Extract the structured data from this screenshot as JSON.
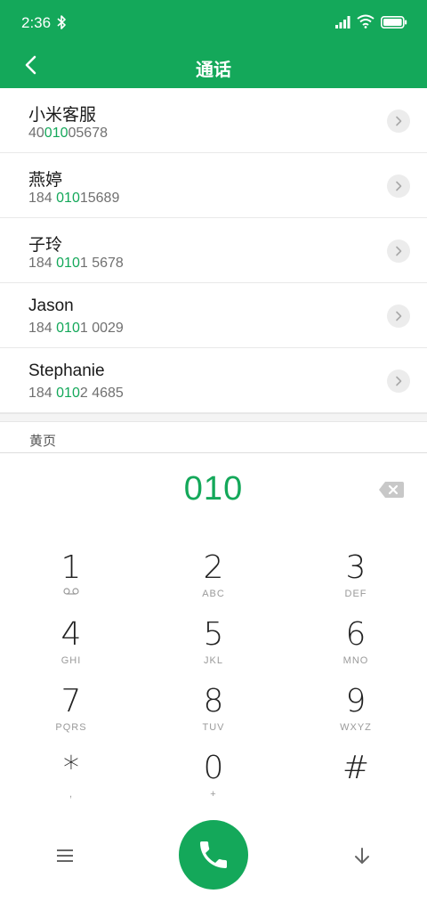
{
  "status_bar": {
    "time": "2:36"
  },
  "header": {
    "title": "通话"
  },
  "contacts": [
    {
      "name": "小米客服",
      "number_pre": "40",
      "number_match": "010",
      "number_post": "05678"
    },
    {
      "name": "燕婷",
      "number_pre": "184 ",
      "number_match": "010",
      "number_post": "15689"
    },
    {
      "name": "子玲",
      "number_pre": "184 ",
      "number_match": "010",
      "number_post": "1 5678"
    },
    {
      "name": "Jason",
      "number_pre": "184 ",
      "number_match": "010",
      "number_post": "1 0029"
    },
    {
      "name": "Stephanie",
      "number_pre": "184 ",
      "number_match": "010",
      "number_post": "2 4685"
    }
  ],
  "yellow_pages": "黄页",
  "dialer": {
    "input": "010",
    "keys": [
      {
        "digit": "1",
        "sub": ""
      },
      {
        "digit": "2",
        "sub": "ABC"
      },
      {
        "digit": "3",
        "sub": "DEF"
      },
      {
        "digit": "4",
        "sub": "GHI"
      },
      {
        "digit": "5",
        "sub": "JKL"
      },
      {
        "digit": "6",
        "sub": "MNO"
      },
      {
        "digit": "7",
        "sub": "PQRS"
      },
      {
        "digit": "8",
        "sub": "TUV"
      },
      {
        "digit": "9",
        "sub": "WXYZ"
      },
      {
        "digit": "*",
        "sub": ","
      },
      {
        "digit": "0",
        "sub": "+"
      },
      {
        "digit": "#",
        "sub": ""
      }
    ]
  },
  "colors": {
    "accent": "#14a85a",
    "match_highlight": "#14a85a"
  },
  "icons": [
    "bluetooth-icon",
    "signal-icon",
    "wifi-icon",
    "battery-icon",
    "back-arrow-icon",
    "chevron-right-icon",
    "backspace-icon",
    "voicemail-icon",
    "menu-icon",
    "phone-icon",
    "collapse-arrow-icon"
  ]
}
